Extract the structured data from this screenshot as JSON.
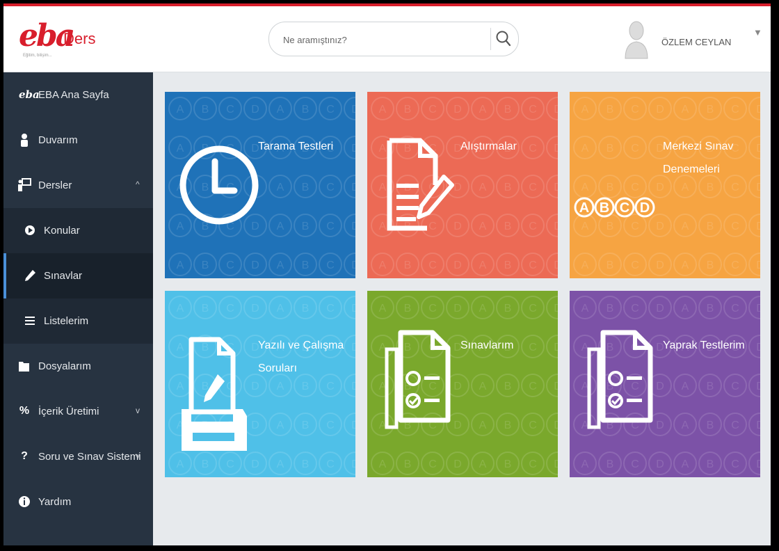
{
  "app": {
    "logo_text": "eba",
    "logo_subtext": "Ders",
    "logo_tagline": "Eğitim, bilişim..."
  },
  "search": {
    "placeholder": "Ne aramıştınız?",
    "value": ""
  },
  "user": {
    "name": "ÖZLEM CEYLAN",
    "menu_caret": "▼"
  },
  "sidebar": {
    "items": [
      {
        "label": "EBA Ana Sayfa",
        "icon": "eba-logo-icon"
      },
      {
        "label": "Duvarım",
        "icon": "person-icon"
      },
      {
        "label": "Dersler",
        "icon": "presentation-board-icon",
        "caret": "^",
        "expanded": true
      },
      {
        "label": "Konular",
        "icon": "play-circle-icon",
        "sub": true
      },
      {
        "label": "Sınavlar",
        "icon": "pencil-icon",
        "sub": true,
        "active": true
      },
      {
        "label": "Listelerim",
        "icon": "list-icon",
        "sub": true
      },
      {
        "label": "Dosyalarım",
        "icon": "folder-icon"
      },
      {
        "label": "İçerik Üretimi",
        "icon": "percent-icon",
        "caret": "v",
        "expanded": false
      },
      {
        "label": "Soru ve Sınav Sistemi",
        "icon": "question-percent-icon",
        "caret": "v",
        "expanded": false
      },
      {
        "label": "Yardım",
        "icon": "info-icon"
      }
    ]
  },
  "tiles": [
    {
      "title": "Tarama Testleri",
      "color": "#1f72b8",
      "icon": "clock-icon"
    },
    {
      "title": "Alıştırmalar",
      "color": "#ec6a55",
      "icon": "document-pen-icon"
    },
    {
      "title": "Merkezi Sınav Denemeleri",
      "color": "#f6a442",
      "icon": "abcd-options-icon"
    },
    {
      "title": "Yazılı ve Çalışma Soruları",
      "color": "#4fc0e8",
      "icon": "printer-document-icon"
    },
    {
      "title": "Sınavlarım",
      "color": "#7aa82c",
      "icon": "checklist-documents-icon"
    },
    {
      "title": "Yaprak Testlerim",
      "color": "#7c52a7",
      "icon": "checklist-documents-icon"
    }
  ],
  "option_letters": [
    "A",
    "B",
    "C",
    "D"
  ],
  "colors": {
    "accent_red": "#d81e2c",
    "sidebar_bg": "#273341",
    "active_indicator": "#4a90d9"
  }
}
